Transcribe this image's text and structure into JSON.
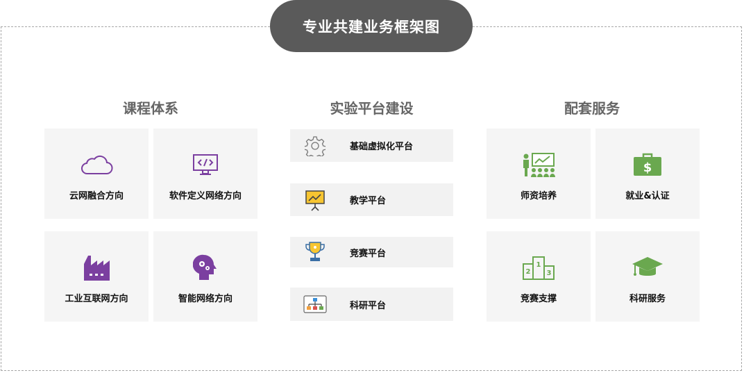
{
  "title": "专业共建业务框架图",
  "columns": {
    "curriculum": {
      "heading": "课程体系",
      "items": [
        {
          "label": "云网融合方向",
          "icon": "cloud-icon"
        },
        {
          "label": "软件定义网络方向",
          "icon": "code-monitor-icon"
        },
        {
          "label": "工业互联网方向",
          "icon": "factory-icon"
        },
        {
          "label": "智能网络方向",
          "icon": "brain-gears-icon"
        }
      ]
    },
    "lab": {
      "heading": "实验平台建设",
      "items": [
        {
          "label": "基础虚拟化平台",
          "icon": "gear-icon"
        },
        {
          "label": "教学平台",
          "icon": "presentation-board-icon"
        },
        {
          "label": "竞赛平台",
          "icon": "trophy-icon"
        },
        {
          "label": "科研平台",
          "icon": "org-chart-icon"
        }
      ]
    },
    "services": {
      "heading": "配套服务",
      "items": [
        {
          "label": "师资培养",
          "icon": "teacher-icon"
        },
        {
          "label": "就业&认证",
          "icon": "briefcase-dollar-icon"
        },
        {
          "label": "竞赛支撑",
          "icon": "podium-icon"
        },
        {
          "label": "科研服务",
          "icon": "graduation-cap-icon"
        }
      ]
    }
  },
  "colors": {
    "purple": "#7b3fa0",
    "green": "#6aa84f",
    "title_bg": "#5a5a5a"
  }
}
